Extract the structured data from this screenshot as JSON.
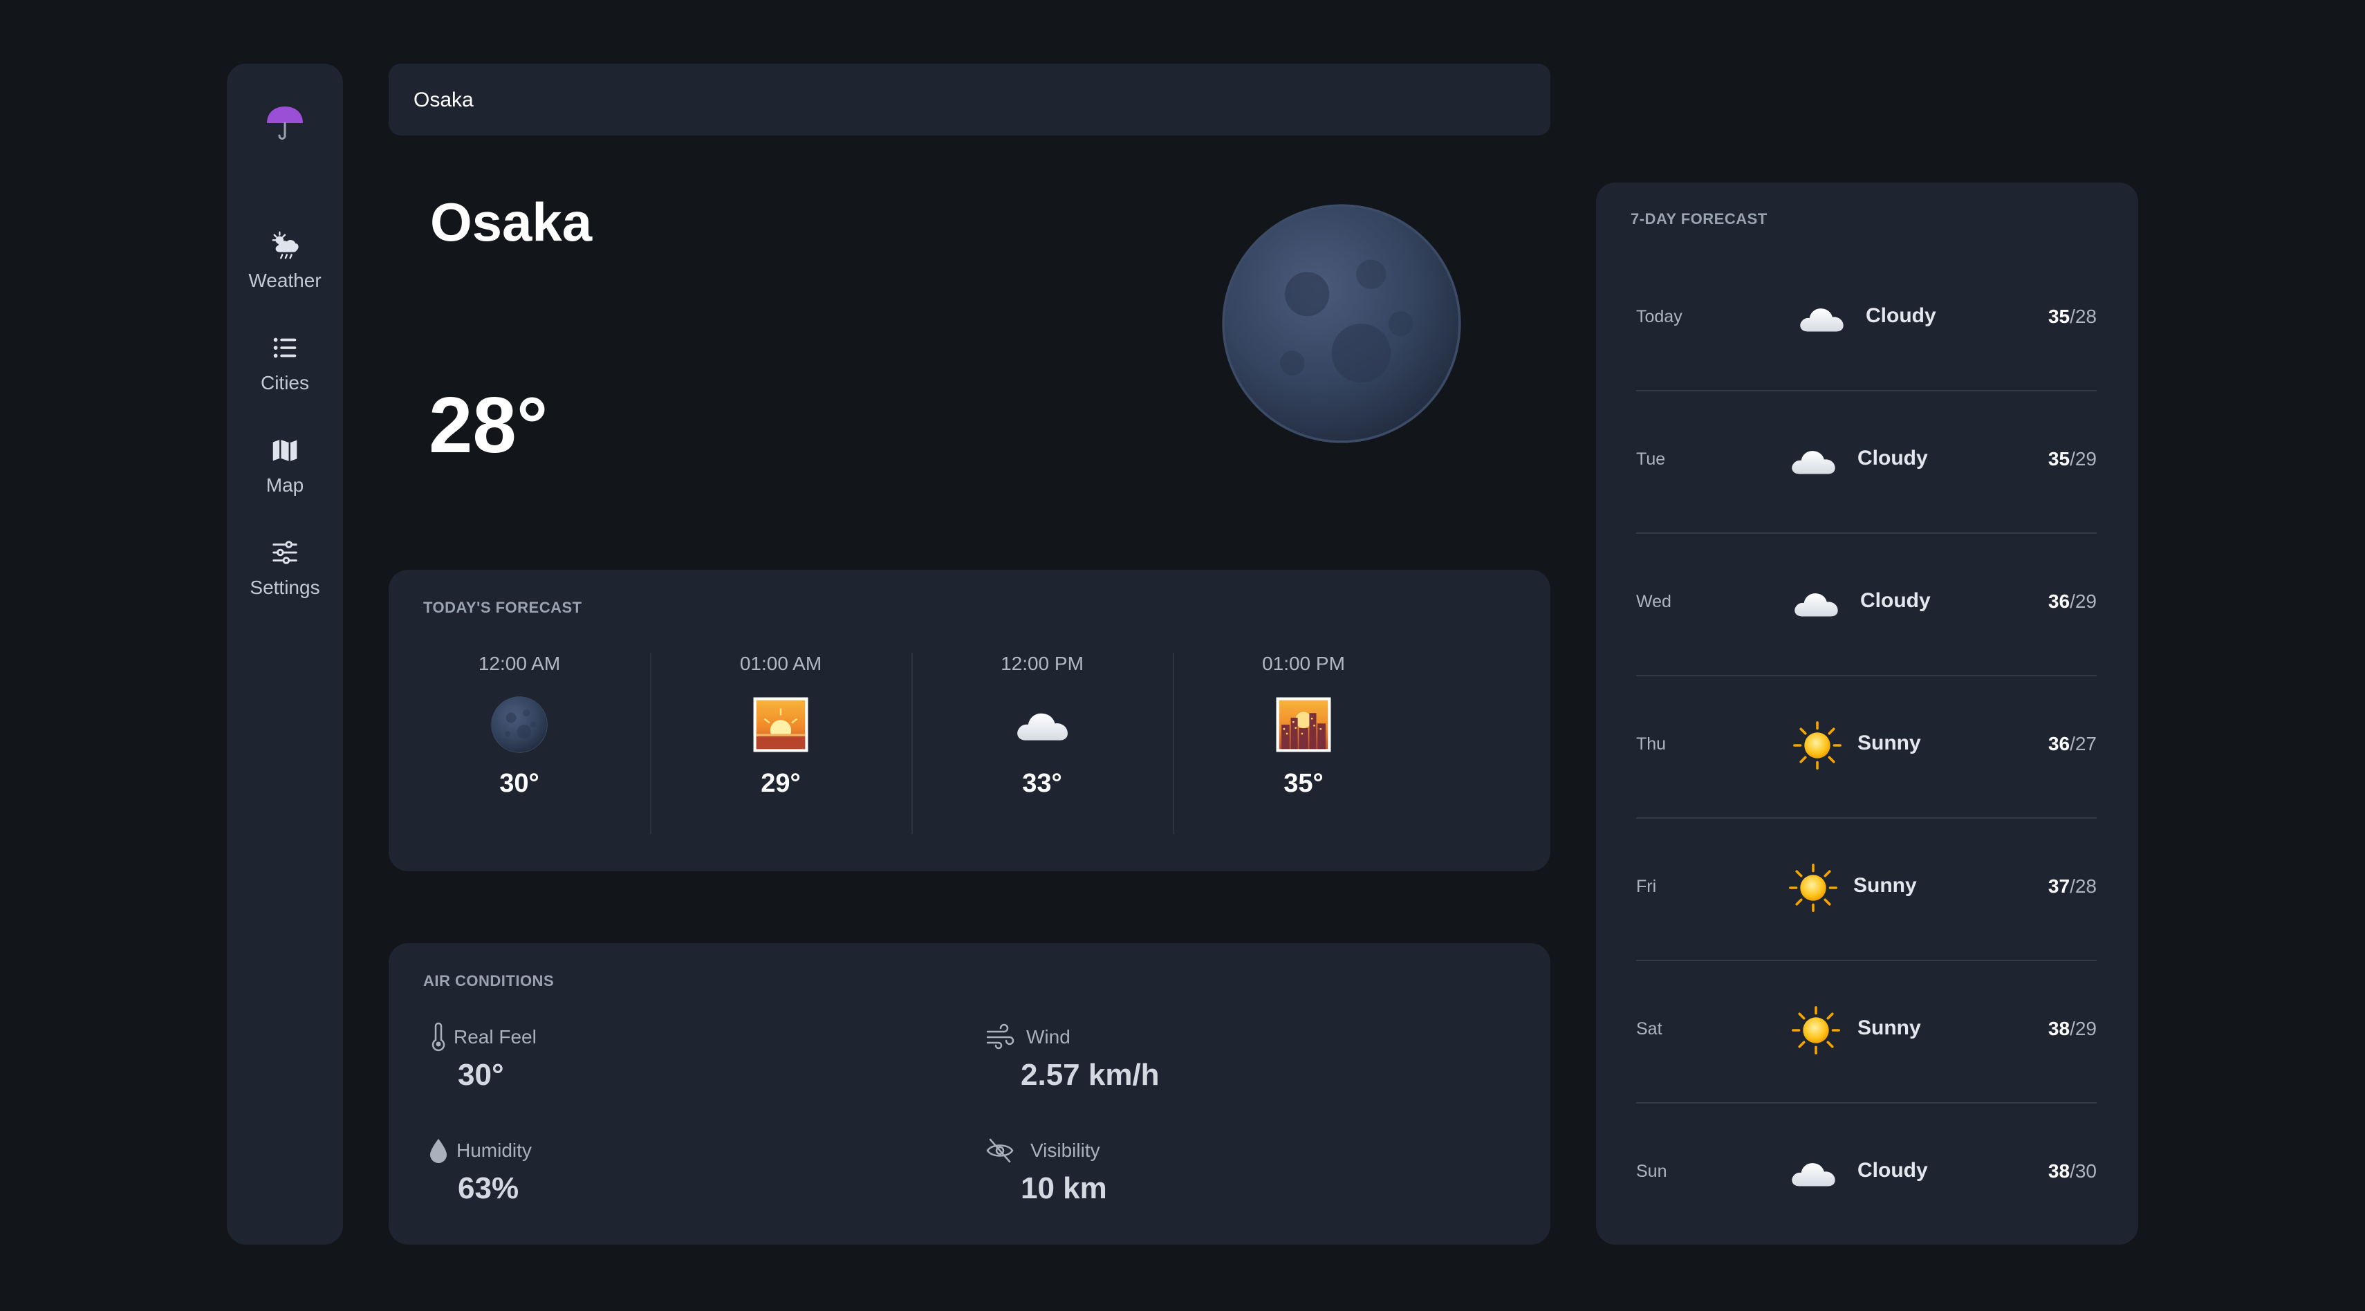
{
  "search": {
    "value": "Osaka"
  },
  "nav": [
    {
      "label": "Weather",
      "icon": "weather-icon"
    },
    {
      "label": "Cities",
      "icon": "list-icon"
    },
    {
      "label": "Map",
      "icon": "map-icon"
    },
    {
      "label": "Settings",
      "icon": "sliders-icon"
    }
  ],
  "accent_color": "#9b4fd6",
  "hero": {
    "city": "Osaka",
    "temperature": "28°",
    "icon": "moon-icon"
  },
  "today_forecast": {
    "title": "TODAY'S FORECAST",
    "hours": [
      {
        "time": "12:00 AM",
        "icon": "moon-icon",
        "temp": "30°"
      },
      {
        "time": "01:00 AM",
        "icon": "sunrise-icon",
        "temp": "29°"
      },
      {
        "time": "12:00 PM",
        "icon": "cloud-icon",
        "temp": "33°"
      },
      {
        "time": "01:00 PM",
        "icon": "city-sunset-icon",
        "temp": "35°"
      }
    ]
  },
  "air_conditions": {
    "title": "AIR CONDITIONS",
    "items": [
      {
        "label": "Real Feel",
        "value": "30°",
        "icon": "thermometer-icon"
      },
      {
        "label": "Wind",
        "value": "2.57 km/h",
        "icon": "wind-icon"
      },
      {
        "label": "Humidity",
        "value": "63%",
        "icon": "droplet-icon"
      },
      {
        "label": "Visibility",
        "value": "10 km",
        "icon": "eye-slash-icon"
      }
    ]
  },
  "weekly": {
    "title": "7-DAY FORECAST",
    "days": [
      {
        "day": "Today",
        "icon": "cloud-icon",
        "condition": "Cloudy",
        "high": "35",
        "low": "/28"
      },
      {
        "day": "Tue",
        "icon": "cloud-icon",
        "condition": "Cloudy",
        "high": "35",
        "low": "/29"
      },
      {
        "day": "Wed",
        "icon": "cloud-icon",
        "condition": "Cloudy",
        "high": "36",
        "low": "/29"
      },
      {
        "day": "Thu",
        "icon": "sun-icon",
        "condition": "Sunny",
        "high": "36",
        "low": "/27"
      },
      {
        "day": "Fri",
        "icon": "sun-icon",
        "condition": "Sunny",
        "high": "37",
        "low": "/28"
      },
      {
        "day": "Sat",
        "icon": "sun-icon",
        "condition": "Sunny",
        "high": "38",
        "low": "/29"
      },
      {
        "day": "Sun",
        "icon": "cloud-icon",
        "condition": "Cloudy",
        "high": "38",
        "low": "/30"
      }
    ]
  }
}
